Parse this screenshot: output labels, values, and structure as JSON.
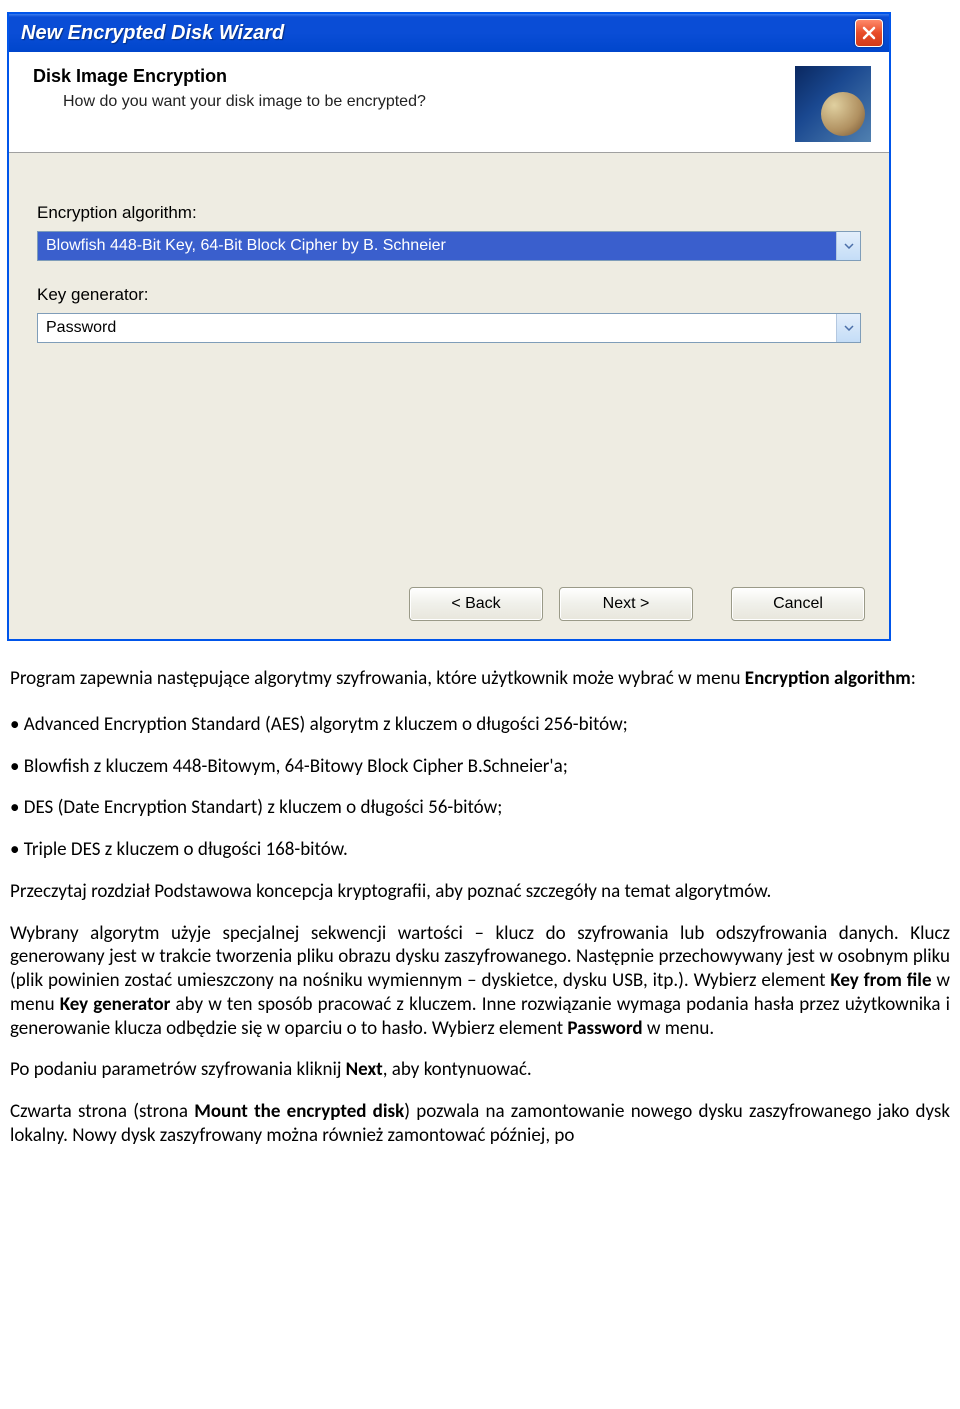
{
  "window": {
    "title": "New Encrypted Disk Wizard"
  },
  "header": {
    "title": "Disk Image Encryption",
    "subtitle": "How do you want your disk image to be encrypted?"
  },
  "form": {
    "algorithm_label": "Encryption algorithm:",
    "algorithm_selected": "Blowfish 448-Bit Key, 64-Bit Block Cipher by B. Schneier",
    "keygen_label": "Key generator:",
    "keygen_selected": "Password"
  },
  "buttons": {
    "back": "< Back",
    "next": "Next >",
    "cancel": "Cancel"
  },
  "doc": {
    "intro_a": "Program zapewnia następujące algorytmy szyfrowania, które użytkownik może wybrać w menu ",
    "intro_bold": "Encryption algorithm",
    "intro_b": ":",
    "bullets": [
      "Advanced Encryption Standard (AES) algorytm z kluczem o długości 256-bitów;",
      "Blowfish z kluczem 448-Bitowym, 64-Bitowy Block Cipher B.Schneier'a;",
      "DES (Date Encryption Standart) z kluczem o długości 56-bitów;",
      "Triple DES z kluczem o długości 168-bitów."
    ],
    "p_read": "Przeczytaj rozdział Podstawowa koncepcja kryptografii, aby poznać szczegóły na temat algorytmów.",
    "p_alg_a": "Wybrany algorytm użyje specjalnej sekwencji wartości – klucz do szyfrowania lub odszyfrowania danych. Klucz generowany jest w trakcie tworzenia pliku obrazu dysku zaszyfrowanego. Następnie przechowywany jest w osobnym pliku (plik powinien zostać umieszczony na nośniku wymiennym – dyskietce, dysku USB, itp.). Wybierz element ",
    "p_alg_b1": "Key from file",
    "p_alg_c": " w menu ",
    "p_alg_b2": "Key generator",
    "p_alg_d": " aby w ten sposób pracować z kluczem. Inne rozwiązanie wymaga podania hasła przez użytkownika i generowanie klucza odbędzie się w oparciu o to hasło. Wybierz element ",
    "p_alg_b3": "Password",
    "p_alg_e": " w menu.",
    "p_next_a": "Po podaniu parametrów szyfrowania kliknij ",
    "p_next_b": "Next",
    "p_next_c": ", aby kontynuować.",
    "p_mount_a": "Czwarta strona (strona ",
    "p_mount_b": "Mount the encrypted disk",
    "p_mount_c": ") pozwala na zamontowanie nowego dysku zaszyfrowanego jako dysk lokalny. Nowy dysk zaszyfrowany można również zamontować później, po"
  }
}
